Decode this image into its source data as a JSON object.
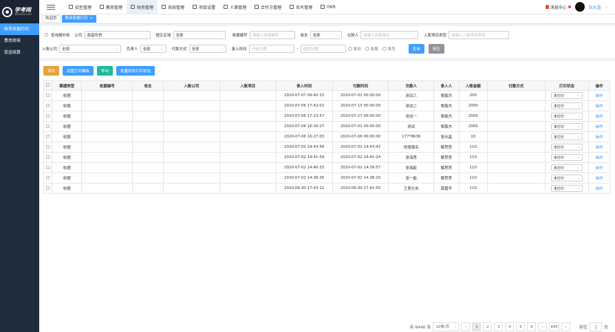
{
  "brand": {
    "logo_text": "学考网",
    "logo_sub": "360xkw.com"
  },
  "sidebar": {
    "items": [
      {
        "label": "账单收据打印"
      },
      {
        "label": "费用审核"
      },
      {
        "label": "奖金结算"
      }
    ]
  },
  "topmenu": {
    "items": [
      {
        "label": "招生管理"
      },
      {
        "label": "教务管理"
      },
      {
        "label": "财务管理"
      },
      {
        "label": "系统管理"
      },
      {
        "label": "项目设置"
      },
      {
        "label": "人事管理"
      },
      {
        "label": "合作方管理"
      },
      {
        "label": "名片管理"
      },
      {
        "label": "OKR"
      }
    ]
  },
  "header": {
    "messages": "消息中心",
    "user": "张水晶"
  },
  "tabs": [
    {
      "label": "欢迎页"
    },
    {
      "label": "账单收据打印"
    }
  ],
  "filters": {
    "out_school": "查询报外校",
    "company_label": "公司",
    "company_value": "南昌传誉",
    "region_label": "报生区域",
    "region_value": "全部",
    "receipt_label": "收据编号",
    "receipt_ph": "请输入收据编号",
    "inout_label": "收支",
    "inout_value": "全部",
    "payer_label": "交款人",
    "payer_ph": "请输入交款单位",
    "proj_type_label": "入账项目类型",
    "proj_type_ph": "请输入入账项目类型",
    "in_company_label": "入账公司",
    "in_company_value": "全部",
    "owner_label": "负责人",
    "owner_value": "全部",
    "pay_method_label": "付款方式",
    "pay_method_value": "全部",
    "entry_time_label": "录入时间",
    "start_ph": "开始日期",
    "end_ph": "结束日期",
    "dash": "-",
    "r_today": "本日",
    "r_week": "本周",
    "r_month": "本月",
    "search": "查询",
    "clear": "清空"
  },
  "actions": {
    "add": "添加",
    "set_template": "设置打印模板",
    "export": "导出",
    "batch": "批量修改打印状态"
  },
  "table": {
    "headers": [
      "票据类型",
      "收据编号",
      "收支",
      "入账公司",
      "入账项目",
      "录入时间",
      "付款时间",
      "交款人",
      "录入人",
      "入账金额",
      "付款方式",
      "打印状态",
      "操作"
    ],
    "rows": [
      {
        "type": "收据",
        "time": "2020-07-07 09:40:15",
        "pay": "2020-07-01 00:00:00",
        "payer": "测试三",
        "by": "黎鑫杰",
        "amt": "200"
      },
      {
        "type": "收据",
        "time": "2020-07-06 17:42:02",
        "pay": "2020-07-13 00:00:00",
        "payer": "测试二",
        "by": "黎鑫杰",
        "amt": "2000"
      },
      {
        "type": "收据",
        "time": "2020-07-06 17:23:57",
        "pay": "2020-07-27 00:00:00",
        "payer": "测试一",
        "by": "黎鑫杰",
        "amt": "2000"
      },
      {
        "type": "收据",
        "time": "2020-07-06 16:30:27",
        "pay": "2020-07-01 00:00:00",
        "payer": "测试",
        "by": "黎鑫杰",
        "amt": "2000"
      },
      {
        "type": "收据",
        "time": "2020-07-06 16:27:03",
        "pay": "2020-07-06 00:00:00",
        "payer": "177*8636",
        "by": "张水晶",
        "amt": "10"
      },
      {
        "type": "收据",
        "time": "2020-07-02 14:43:56",
        "pay": "2020-07-02 14:43:42",
        "payer": "快速报名",
        "by": "解思思",
        "amt": "110"
      },
      {
        "type": "收据",
        "time": "2020-07-02 14:41:59",
        "pay": "2020-07-02 14:41:24",
        "payer": "张海思",
        "by": "解思思",
        "amt": "110"
      },
      {
        "type": "收据",
        "time": "2020-07-02 14:40:15",
        "pay": "2020-07-02 14:39:57",
        "payer": "张海能",
        "by": "解思思",
        "amt": "110"
      },
      {
        "type": "收据",
        "time": "2020-07-02 14:38:35",
        "pay": "2020-07-02 14:38:15",
        "payer": "张一能",
        "by": "解思思",
        "amt": "110"
      },
      {
        "type": "收据",
        "time": "2020-06-30 17:43:11",
        "pay": "2020-06-30 17:42:55",
        "payer": "王昆仑央",
        "by": "龚嘉华",
        "amt": "110"
      }
    ],
    "print_status": "未打印",
    "op": "操作"
  },
  "pager": {
    "total": "共 8446 条",
    "size": "10条/页",
    "pages": [
      "1",
      "2",
      "3",
      "4",
      "5",
      "6",
      "···",
      "845"
    ],
    "goto": "前往",
    "page_input": "1",
    "page_unit": "页"
  }
}
